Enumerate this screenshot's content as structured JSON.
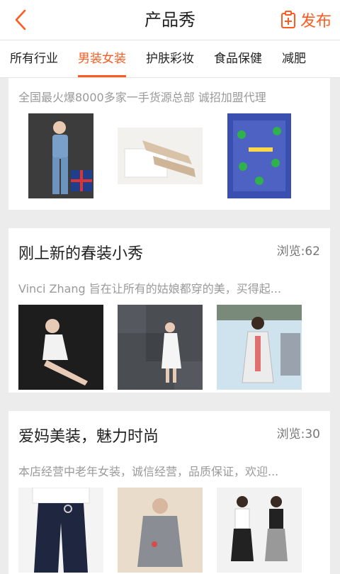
{
  "header": {
    "title": "产品秀",
    "publish_label": "发布"
  },
  "tabs": [
    {
      "label": "所有行业",
      "active": false
    },
    {
      "label": "男装女装",
      "active": true
    },
    {
      "label": "护肤彩妆",
      "active": false
    },
    {
      "label": "食品保健",
      "active": false
    },
    {
      "label": "减肥",
      "active": false
    }
  ],
  "posts": [
    {
      "title": "",
      "views": "",
      "description": "全国最火爆8000多家一手货源总部 诚招加盟代理",
      "images": [
        "model-denim-outfit",
        "beige-pointed-shoes",
        "promo-poster-clovers"
      ]
    },
    {
      "title": "刚上新的春装小秀",
      "views": "浏览:62",
      "description": "Vinci Zhang 旨在让所有的姑娘都穿的美，买得起...",
      "images": [
        "model-white-dress-sitting",
        "model-white-dress-stone",
        "model-lace-outerwear"
      ]
    },
    {
      "title": "爱妈美装，魅力时尚",
      "views": "浏览:30",
      "description": "本店经营中老年女装，诚信经营，品质保证，欢迎...",
      "images": [
        "navy-trousers",
        "grey-coat-mature",
        "two-models-culottes"
      ]
    }
  ],
  "accent_color": "#ff5a1f"
}
